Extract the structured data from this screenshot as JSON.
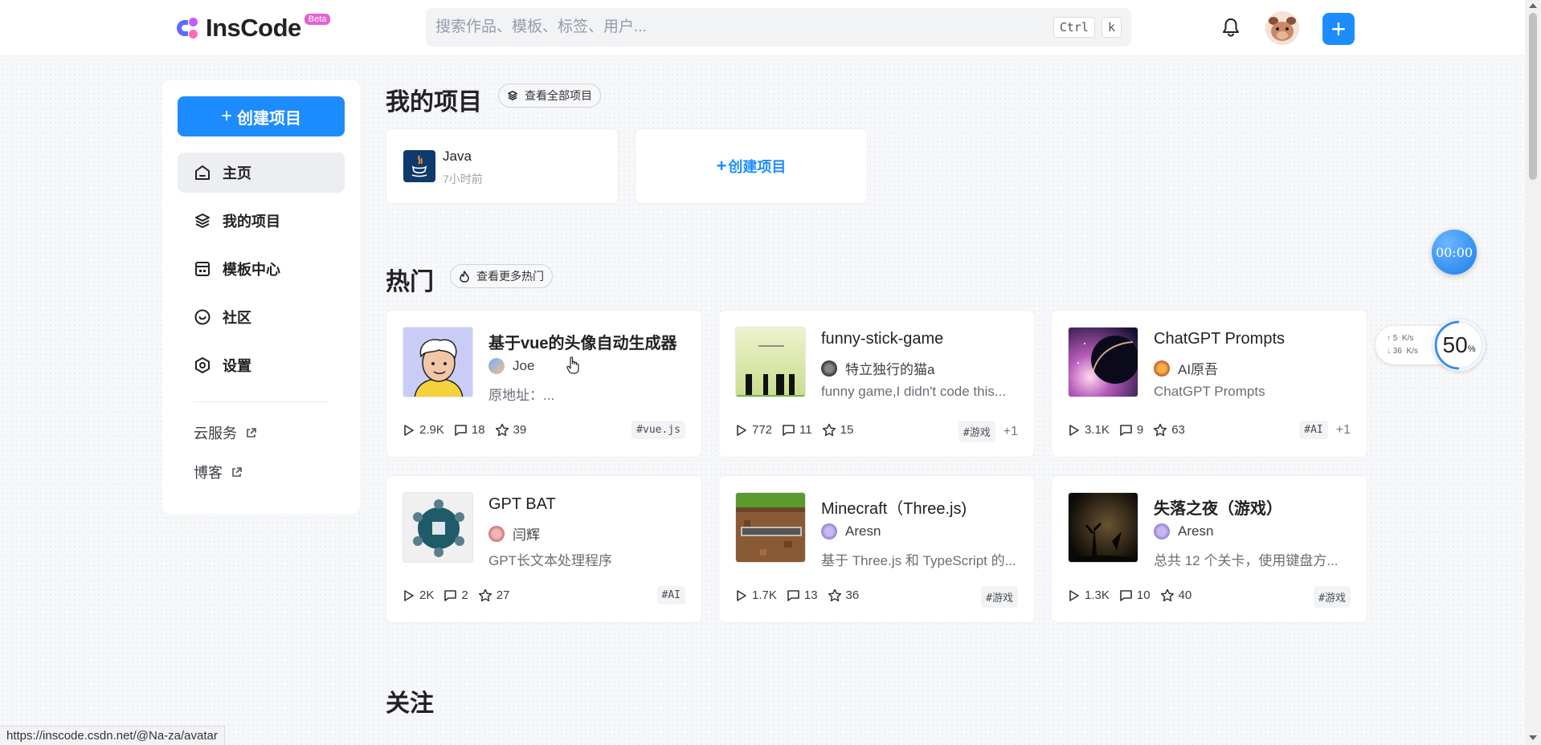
{
  "header": {
    "logo_text": "InsCode",
    "beta_label": "Beta",
    "search_placeholder": "搜索作品、模板、标签、用户...",
    "shortcut_key1": "Ctrl",
    "shortcut_key2": "k",
    "add_label": "+"
  },
  "sidebar": {
    "create_label": "创建项目",
    "items": [
      {
        "label": "主页",
        "icon": "home-icon"
      },
      {
        "label": "我的项目",
        "icon": "layers-icon"
      },
      {
        "label": "模板中心",
        "icon": "template-icon"
      },
      {
        "label": "社区",
        "icon": "community-icon"
      },
      {
        "label": "设置",
        "icon": "settings-icon"
      }
    ],
    "links": [
      {
        "label": "云服务"
      },
      {
        "label": "博客"
      }
    ]
  },
  "my_projects": {
    "title": "我的项目",
    "view_all_label": "查看全部项目",
    "project": {
      "name": "Java",
      "time": "7小时前"
    },
    "create_label": "创建项目"
  },
  "hot": {
    "title": "热门",
    "view_more_label": "查看更多热门",
    "cards": [
      {
        "title": "基于vue的头像自动生成器",
        "author": "Joe",
        "desc": "原地址：...",
        "views": "2.9K",
        "comments": "18",
        "stars": "39",
        "tag": "#vue.js",
        "more": ""
      },
      {
        "title": "funny-stick-game",
        "author": "特立独行的猫a",
        "desc": "funny game,I didn't code this...",
        "views": "772",
        "comments": "11",
        "stars": "15",
        "tag": "#游戏",
        "more": "+1"
      },
      {
        "title": "ChatGPT Prompts",
        "author": "AI原吾",
        "desc": "ChatGPT Prompts",
        "views": "3.1K",
        "comments": "9",
        "stars": "63",
        "tag": "#AI",
        "more": "+1"
      },
      {
        "title": "GPT BAT",
        "author": "闫辉",
        "desc": "GPT长文本处理程序",
        "views": "2K",
        "comments": "2",
        "stars": "27",
        "tag": "#AI",
        "more": ""
      },
      {
        "title": "Minecraft（Three.js)",
        "author": "Aresn",
        "desc": "基于 Three.js 和 TypeScript 的...",
        "views": "1.7K",
        "comments": "13",
        "stars": "36",
        "tag": "#游戏",
        "more": ""
      },
      {
        "title": "失落之夜（游戏）",
        "author": "Aresn",
        "desc": "总共 12 个关卡，使用键盘方...",
        "views": "1.3K",
        "comments": "10",
        "stars": "40",
        "tag": "#游戏",
        "more": ""
      }
    ]
  },
  "follow": {
    "title": "关注"
  },
  "widgets": {
    "timer": "00:00",
    "upload": "5",
    "download": "36",
    "speed_unit": "K/s",
    "cpu_value": "50",
    "cpu_unit": "%"
  },
  "status_url": "https://inscode.csdn.net/@Na-za/avatar",
  "colors": {
    "accent": "#1c8cff",
    "text": "#222226"
  }
}
